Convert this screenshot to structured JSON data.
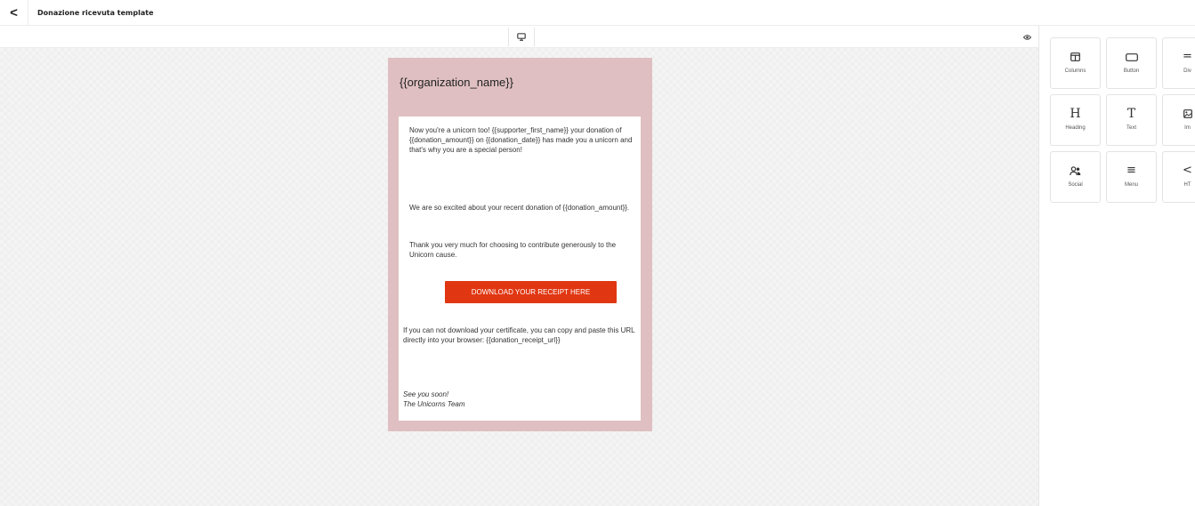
{
  "header": {
    "back_icon": "chevron-left-icon",
    "back_glyph": "<",
    "title": "Donazione ricevuta template"
  },
  "toolbar": {
    "device_icon": "desktop-monitor-icon",
    "preview_icon": "eye-icon"
  },
  "email": {
    "background_color": "#dfbfc1",
    "organization_name": "{{organization_name}}",
    "paragraph_1": "Now you're a unicorn too! {{supporter_first_name}} your donation of {{donation_amount}} on {{donation_date}} has made you a unicorn and that's why you are a special person!",
    "paragraph_2": "We are so excited about your recent donation of {{donation_amount}}.",
    "paragraph_3": "Thank you very much for choosing to contribute generously to the Unicorn cause.",
    "button_label": "DOWNLOAD YOUR RECEIPT HERE",
    "button_color": "#e03712",
    "paragraph_4": "If you can not download your certificate, you can copy and paste this URL directly into your browser: {{donation_receipt_url}}",
    "signoff_line_1": "See you soon!",
    "signoff_line_2": "The Unicorns Team"
  },
  "blocks": [
    {
      "label": "Columns",
      "icon": "columns-icon",
      "glyph": ""
    },
    {
      "label": "Button",
      "icon": "button-icon",
      "glyph": ""
    },
    {
      "label": "Div",
      "icon": "divider-icon",
      "glyph": "="
    },
    {
      "label": "Heading",
      "icon": "heading-icon",
      "glyph": "H"
    },
    {
      "label": "Text",
      "icon": "text-icon",
      "glyph": "T"
    },
    {
      "label": "Im",
      "icon": "image-icon",
      "glyph": ""
    },
    {
      "label": "Social",
      "icon": "social-icon",
      "glyph": ""
    },
    {
      "label": "Menu",
      "icon": "menu-icon",
      "glyph": "≡"
    },
    {
      "label": "HT",
      "icon": "html-icon",
      "glyph": "<"
    }
  ]
}
